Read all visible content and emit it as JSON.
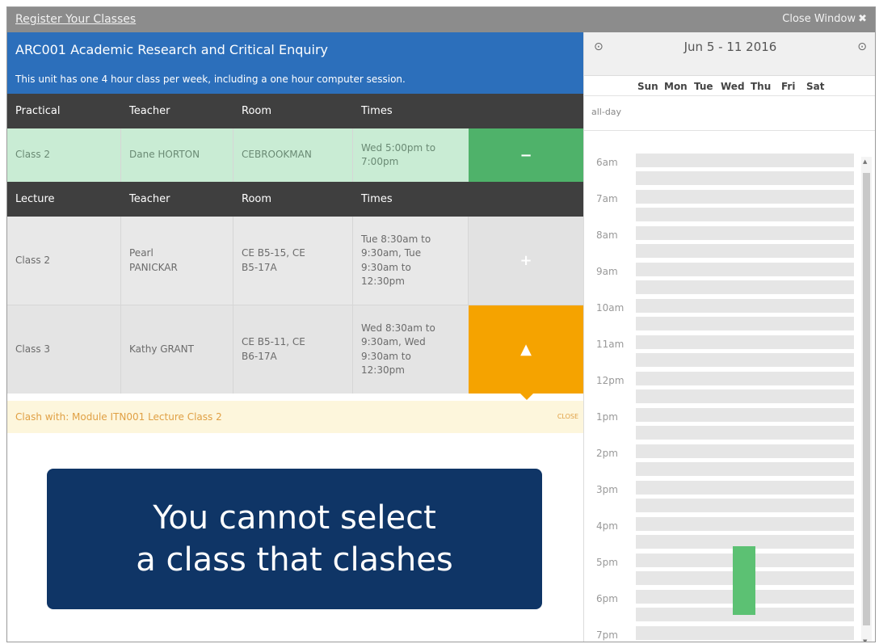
{
  "window": {
    "title": "Register Your Classes",
    "close_label": "Close Window",
    "close_icon": "✖"
  },
  "unit": {
    "title": "ARC001 Academic Research and Critical Enquiry",
    "description": "This unit has one 4 hour class per week, including a one hour computer session."
  },
  "practical": {
    "headers": [
      "Practical",
      "Teacher",
      "Room",
      "Times"
    ],
    "rows": [
      {
        "class": "Class 2",
        "teacher": "Dane HORTON",
        "room": "CEBROOKMAN",
        "times": "Wed 5:00pm to\n7:00pm",
        "action": "−"
      }
    ]
  },
  "lecture": {
    "headers": [
      "Lecture",
      "Teacher",
      "Room",
      "Times"
    ],
    "rows": [
      {
        "class": "Class 2",
        "teacher": "Pearl\nPANICKAR",
        "room": "CE B5-15, CE\nB5-17A",
        "times": "Tue 8:30am to\n9:30am, Tue\n9:30am to\n12:30pm",
        "action": "+"
      },
      {
        "class": "Class 3",
        "teacher": "Kathy GRANT",
        "room": "CE B5-11, CE\nB6-17A",
        "times": "Wed 8:30am to\n9:30am, Wed\n9:30am to\n12:30pm",
        "action": "▲"
      }
    ]
  },
  "clash": {
    "message": "Clash with: Module ITN001 Lecture Class 2",
    "dismiss": "CLOSE"
  },
  "banner": {
    "line1": "You cannot select",
    "line2": "a class that clashes"
  },
  "calendar": {
    "prev_icon": "⊙",
    "next_icon": "⊙",
    "range": "Jun 5 - 11 2016",
    "days": [
      "Sun",
      "Mon",
      "Tue",
      "Wed",
      "Thu",
      "Fri",
      "Sat"
    ],
    "allday_label": "all-day",
    "hours": [
      "6am",
      "7am",
      "8am",
      "9am",
      "10am",
      "11am",
      "12pm",
      "1pm",
      "2pm",
      "3pm",
      "4pm",
      "5pm",
      "6pm",
      "7pm"
    ],
    "event_color": "#5cc173"
  },
  "colors": {
    "header_blue": "#2c6fbb",
    "table_head": "#3f3f3f",
    "selected_green": "#4fb26a",
    "warning_orange": "#f5a300",
    "banner_navy": "#0f3566"
  }
}
